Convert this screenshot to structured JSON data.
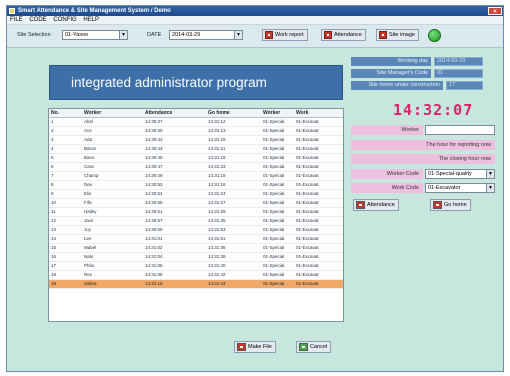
{
  "window": {
    "title": "Smart Attendance & Site Management System  / Demo",
    "close": "×"
  },
  "menu": [
    "FILE",
    "CODE",
    "CONFIG",
    "HELP"
  ],
  "toolbar": {
    "site_label": "Site Selection",
    "site_value": "01-Yasoo",
    "date_label": "DATE",
    "date_value": "2014-03-29",
    "buttons": [
      "Work report",
      "Attendance",
      "Site image"
    ]
  },
  "banner": "integrated administrator program",
  "info": [
    {
      "label": "Working day",
      "value": "2014-03-29"
    },
    {
      "label": "Site Manager's Code",
      "value": "01"
    },
    {
      "label": "Site home under construction",
      "value": "17"
    }
  ],
  "clock": "14:32:07",
  "form": {
    "worker_label": "Worker",
    "worker_value": "",
    "report_hour": "The hour for reporting  now",
    "closing_hour": "The closing hour  now",
    "worker_code_label": "Worker Code",
    "worker_code_value": "01-Special-quality",
    "work_code_label": "Work Code",
    "work_code_value": "01-Excavator",
    "attendance_btn": "Attendance",
    "gohome_btn": "Go home"
  },
  "table": {
    "columns": [
      "No.",
      "Worker",
      "Attendance",
      "Go home",
      "Worker",
      "Work"
    ],
    "rows": [
      [
        "1",
        "Abel",
        "14:30:37",
        "14:31:12",
        "01-Special",
        "01-Excavat"
      ],
      [
        "2",
        "Ace",
        "14:30:39",
        "14:31:13",
        "01-Special",
        "01-Excavat"
      ],
      [
        "3",
        "Ada",
        "14:30:42",
        "14:31:15",
        "01-Special",
        "01-Excavat"
      ],
      [
        "4",
        "Baron",
        "14:30:43",
        "14:31:21",
        "01-Special",
        "01-Excavat"
      ],
      [
        "5",
        "Bano",
        "14:30:45",
        "14:31:18",
        "01-Special",
        "01-Excavat"
      ],
      [
        "6",
        "Cara",
        "14:30:47",
        "14:31:23",
        "01-Special",
        "01-Excavat"
      ],
      [
        "7",
        "Champ",
        "14:30:49",
        "14:31:18",
        "01-Special",
        "01-Excavat"
      ],
      [
        "8",
        "Dex",
        "14:30:53",
        "14:31:16",
        "01-Special",
        "01-Excavat"
      ],
      [
        "9",
        "Elis",
        "14:30:54",
        "14:31:24",
        "01-Special",
        "01-Excavat"
      ],
      [
        "10",
        "Fifa",
        "14:30:56",
        "14:31:27",
        "01-Special",
        "01-Excavat"
      ],
      [
        "11",
        "Hailey",
        "14:30:51",
        "14:31:29",
        "01-Special",
        "01-Excavat"
      ],
      [
        "12",
        "Jace",
        "14:30:57",
        "14:31:35",
        "01-Special",
        "01-Excavat"
      ],
      [
        "13",
        "Joy",
        "14:30:59",
        "14:31:53",
        "01-Special",
        "01-Excavat"
      ],
      [
        "14",
        "Lee",
        "14:31:01",
        "14:31:51",
        "01-Special",
        "01-Excavat"
      ],
      [
        "15",
        "Mabel",
        "14:31:02",
        "14:31:36",
        "01-Special",
        "01-Excavat"
      ],
      [
        "16",
        "Nalo",
        "14:31:04",
        "14:31:39",
        "01-Special",
        "01-Excavat"
      ],
      [
        "17",
        "Phila",
        "14:31:06",
        "14:31:40",
        "01-Special",
        "01-Excavat"
      ],
      [
        "18",
        "Rex",
        "14:31:08",
        "14:31:42",
        "01-Special",
        "01-Excavat"
      ],
      [
        "19",
        "Salina",
        "14:31:10",
        "14:31:44",
        "01-Special",
        "01-Excavat"
      ]
    ],
    "selected_index": 18
  },
  "bottom": {
    "save_btn": "Make File",
    "cancel_btn": "Cancel"
  },
  "colors": {
    "background": "#c7e6dd",
    "banner": "#3d6fa8",
    "selected_row": "#f0a868",
    "clock": "#d9246a",
    "status_light": "#17951f"
  }
}
